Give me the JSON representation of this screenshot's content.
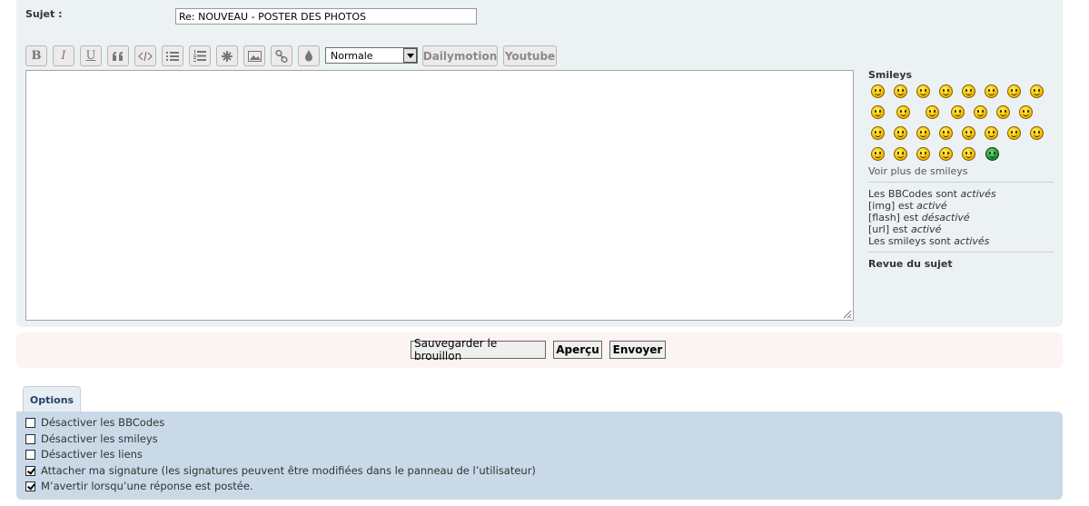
{
  "subject": {
    "label": "Sujet :",
    "value": "Re: NOUVEAU - POSTER DES PHOTOS"
  },
  "toolbar": {
    "bold_label": "B",
    "italic_label": "I",
    "underline_label": "U",
    "font_size_value": "Normale",
    "dailymotion_label": "Dailymotion",
    "youtube_label": "Youtube"
  },
  "sidebar": {
    "smileys_title": "Smileys",
    "more_smileys": "Voir plus de smileys",
    "bbcode_prefix": "Les BBCodes sont ",
    "bbcode_state": "activés",
    "img_prefix": "[img] est ",
    "img_state": "activé",
    "flash_prefix": "[flash] est ",
    "flash_state": "désactivé",
    "url_prefix": "[url] est ",
    "url_state": "activé",
    "smileys_prefix": "Les smileys sont ",
    "smileys_state": "activés",
    "review_title": "Revue du sujet"
  },
  "buttons": {
    "save_draft": "Sauvegarder le brouillon",
    "preview": "Aperçu",
    "submit": "Envoyer"
  },
  "options": {
    "tab_label": "Options",
    "items": [
      {
        "label": "Désactiver les BBCodes",
        "checked": false
      },
      {
        "label": "Désactiver les smileys",
        "checked": false
      },
      {
        "label": "Désactiver les liens",
        "checked": false
      },
      {
        "label": "Attacher ma signature (les signatures peuvent être modifiées dans le panneau de l’utilisateur)",
        "checked": true
      },
      {
        "label": "M’avertir lorsqu’une réponse est postée.",
        "checked": true
      }
    ]
  }
}
